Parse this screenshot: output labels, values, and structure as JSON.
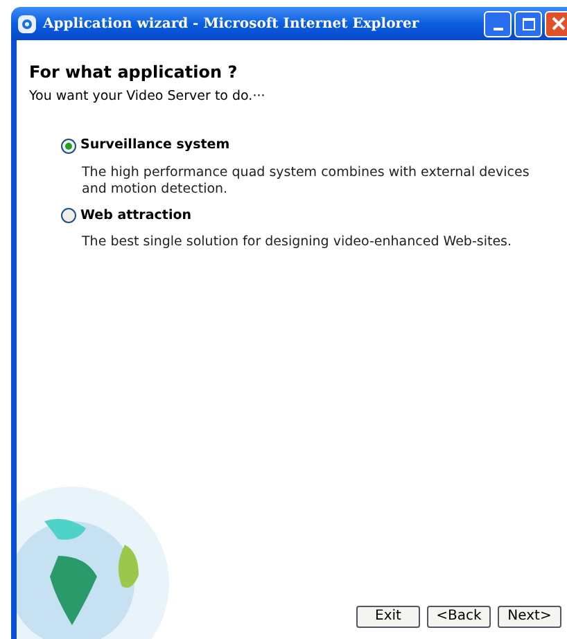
{
  "window": {
    "title": "Application wizard - Microsoft Internet Explorer"
  },
  "heading": "For what application ?",
  "subheading": "You want your Video Server to do.···",
  "options": [
    {
      "label": "Surveillance system",
      "description": "The high performance quad system combines with external devices and motion detection.",
      "selected": true
    },
    {
      "label": "Web attraction",
      "description": "The best single solution for designing video-enhanced Web-sites.",
      "selected": false
    }
  ],
  "buttons": [
    "Exit",
    "<Back",
    "Next>"
  ]
}
